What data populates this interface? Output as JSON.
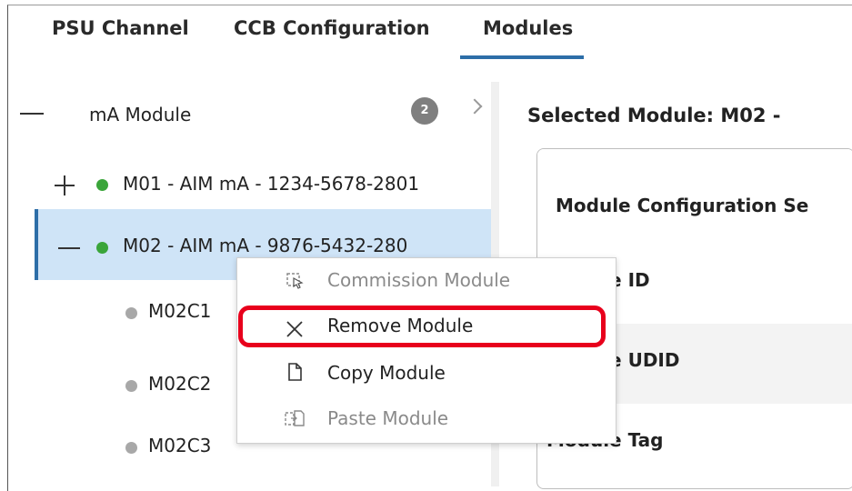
{
  "tabs": [
    {
      "label": "PSU Channel"
    },
    {
      "label": "CCB Configuration"
    },
    {
      "label": "Modules"
    }
  ],
  "tree": {
    "group": {
      "label": "mA Module",
      "count": "2"
    },
    "modules": [
      {
        "label": "M01 - AIM mA - 1234-5678-2801",
        "status": "green"
      },
      {
        "label": "M02 - AIM mA - 9876-5432-280",
        "status": "green"
      }
    ],
    "channels": [
      {
        "label": "M02C1"
      },
      {
        "label": "M02C2"
      },
      {
        "label": "M02C3"
      }
    ]
  },
  "right": {
    "selected_title": "Selected Module: M02 -",
    "config_title": "Module Configuration Se",
    "rows": [
      {
        "label": "Module ID"
      },
      {
        "label": "Module UDID"
      },
      {
        "label": "Module Tag"
      }
    ]
  },
  "context_menu": {
    "items": [
      {
        "label": "Commission Module",
        "icon": "commission-icon",
        "enabled": false
      },
      {
        "label": "Remove Module",
        "icon": "close-icon",
        "enabled": true
      },
      {
        "label": "Copy Module",
        "icon": "document-icon",
        "enabled": true
      },
      {
        "label": "Paste Module",
        "icon": "paste-icon",
        "enabled": false
      }
    ]
  },
  "colors": {
    "accent": "#2d6ea8",
    "selection": "#cfe4f7",
    "status_green": "#3aa53a",
    "highlight_red": "#e8001c"
  }
}
